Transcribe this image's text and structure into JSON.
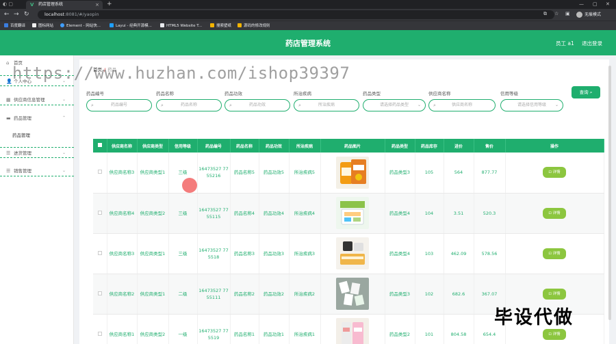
{
  "browser": {
    "tab_title": "药店管理系统",
    "url_host": "localhost",
    "url_rest": ":8081/#/yaopin",
    "profile": "无痕模式",
    "bookmarks": [
      "百度翻译",
      "图标网站",
      "Element - 网站快...",
      "Layui - 经典开源模...",
      "HTML5 Website T...",
      "搜索壁纸",
      "源码的修改规则"
    ]
  },
  "header": {
    "title": "药店管理系统",
    "user": "员工 a1",
    "logout": "退出登录"
  },
  "sidebar": {
    "items": [
      {
        "label": "首页"
      },
      {
        "label": "个人中心"
      },
      {
        "label": "供应商信息管理"
      },
      {
        "label": "药品管理"
      },
      {
        "label": "药品管理"
      },
      {
        "label": "进货管理"
      },
      {
        "label": "销售管理"
      }
    ]
  },
  "breadcrumb": {
    "home": "首页",
    "sep": "/",
    "current": "药品"
  },
  "filters": [
    {
      "label": "药品编号",
      "placeholder": "药品编号"
    },
    {
      "label": "药品名称",
      "placeholder": "药品名称"
    },
    {
      "label": "药品功效",
      "placeholder": "药品功效"
    },
    {
      "label": "所治疾病",
      "placeholder": "所治疾病"
    },
    {
      "label": "药品类型",
      "placeholder": "请选择药品类型"
    },
    {
      "label": "供应商名称",
      "placeholder": "供应商名称"
    },
    {
      "label": "信用等级",
      "placeholder": "请选择信用等级"
    }
  ],
  "query_button": "查询",
  "table": {
    "headers": [
      "供应商名称",
      "供应商类型",
      "信用等级",
      "药品编号",
      "药品名称",
      "药品功效",
      "所治疾病",
      "药品图片",
      "药品类型",
      "药品库存",
      "进价",
      "售价",
      "操作"
    ],
    "rows": [
      {
        "supplier": "供应商名称3",
        "stype": "供应商类型1",
        "credit": "三级",
        "code": "16473527 7755216",
        "name": "药品名称5",
        "effect": "药品功效5",
        "disease": "所治疾病5",
        "ptype": "药品类型3",
        "stock": "105",
        "cost": "564",
        "price": "877.77",
        "action": "详情"
      },
      {
        "supplier": "供应商名称4",
        "stype": "供应商类型2",
        "credit": "三级",
        "code": "16473527 7755115",
        "name": "药品名称4",
        "effect": "药品功效4",
        "disease": "所治疾病4",
        "ptype": "药品类型4",
        "stock": "104",
        "cost": "3.51",
        "price": "520.3",
        "action": "详情"
      },
      {
        "supplier": "供应商名称3",
        "stype": "供应商类型1",
        "credit": "三级",
        "code": "16473527 775518",
        "name": "药品名称3",
        "effect": "药品功效3",
        "disease": "所治疾病3",
        "ptype": "药品类型4",
        "stock": "103",
        "cost": "462.09",
        "price": "578.56",
        "action": "详情"
      },
      {
        "supplier": "供应商名称2",
        "stype": "供应商类型1",
        "credit": "二级",
        "code": "16473527 7755111",
        "name": "药品名称2",
        "effect": "药品功效2",
        "disease": "所治疾病2",
        "ptype": "药品类型3",
        "stock": "102",
        "cost": "682.6",
        "price": "367.07",
        "action": "详情"
      },
      {
        "supplier": "供应商名称1",
        "stype": "供应商类型2",
        "credit": "一级",
        "code": "16473527 775519",
        "name": "药品名称1",
        "effect": "药品功效1",
        "disease": "所治疾病1",
        "ptype": "药品类型2",
        "stock": "101",
        "cost": "804.58",
        "price": "654.4",
        "action": "详情"
      }
    ]
  },
  "overlay": {
    "watermark": "https://www.huzhan.com/ishop39397",
    "promo": "毕设代做"
  },
  "colors": {
    "primary": "#1fae6e",
    "action": "#8cc63f"
  }
}
